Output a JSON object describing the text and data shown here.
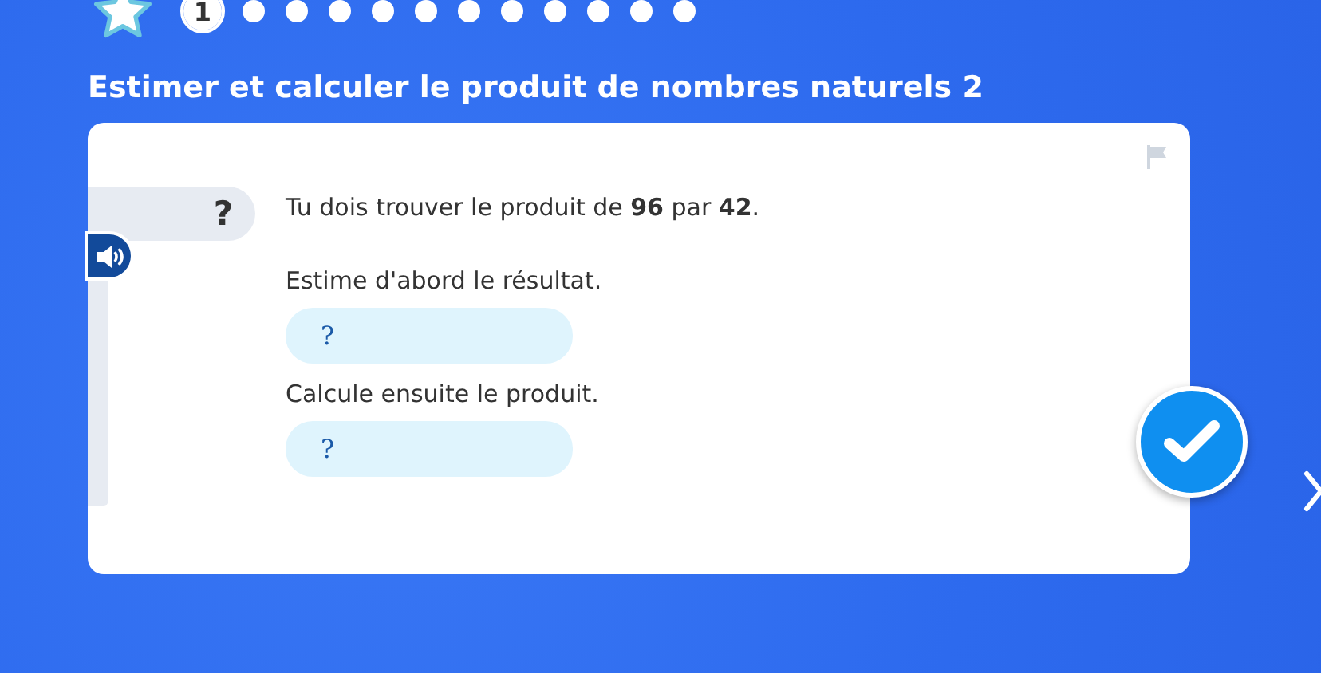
{
  "progress": {
    "steps": [
      {
        "label": "1",
        "selected": true
      },
      {
        "selected": false
      },
      {
        "selected": false
      },
      {
        "selected": false
      },
      {
        "selected": false
      },
      {
        "selected": false
      },
      {
        "selected": false
      },
      {
        "selected": false
      },
      {
        "selected": false
      },
      {
        "selected": false
      },
      {
        "selected": false
      },
      {
        "selected": false
      }
    ]
  },
  "title": "Estimer et calculer le produit de nombres naturels 2",
  "question": {
    "badge": "?",
    "prompt": "Tu dois trouver le produit de **96** par **42**.",
    "parts": [
      {
        "label": "Estime d'abord le résultat.",
        "placeholder": "?"
      },
      {
        "label": "Calcule ensuite le produit.",
        "placeholder": "?"
      }
    ]
  }
}
